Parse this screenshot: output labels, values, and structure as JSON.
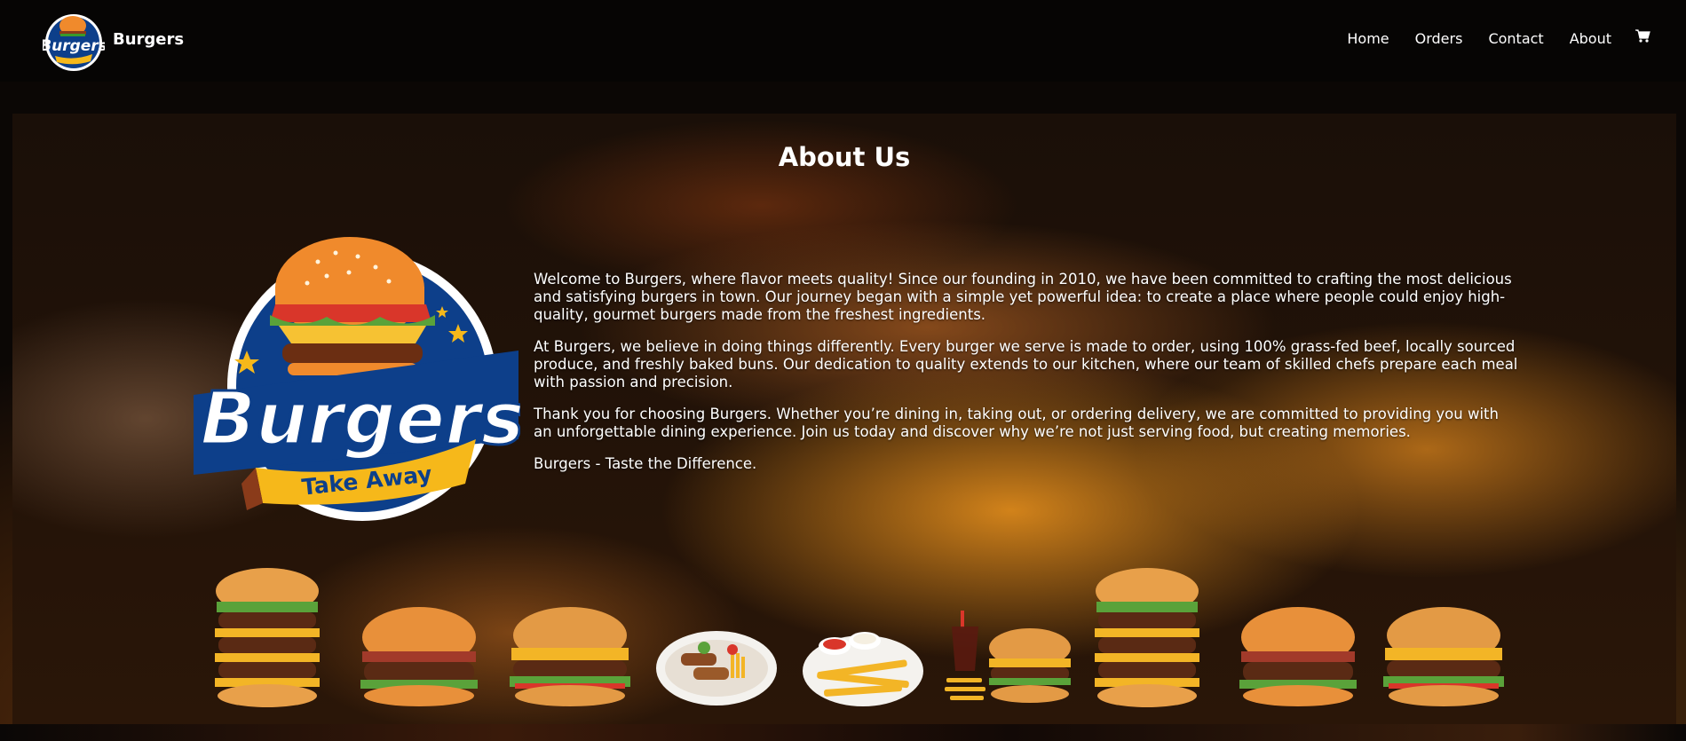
{
  "header": {
    "brand": "Burgers",
    "logo_text": "Burgers",
    "logo_sub": "TAKE AWAY",
    "nav": [
      "Home",
      "Orders",
      "Contact",
      "About"
    ],
    "cart_icon": "cart-icon"
  },
  "about": {
    "title": "About Us",
    "logo_text": "Burgers",
    "logo_sub": "Take Away",
    "paragraphs": [
      "Welcome to Burgers, where flavor meets quality! Since our founding in 2010, we have been committed to crafting the most delicious and satisfying burgers in town. Our journey began with a simple yet powerful idea: to create a place where people could enjoy high-quality, gourmet burgers made from the freshest ingredients.",
      "At Burgers, we believe in doing things differently. Every burger we serve is made to order, using 100% grass-fed beef, locally sourced produce, and freshly baked buns. Our dedication to quality extends to our kitchen, where our team of skilled chefs prepare each meal with passion and precision.",
      "Thank you for choosing Burgers. Whether you’re dining in, taking out, or ordering delivery, we are committed to providing you with an unforgettable dining experience. Join us today and discover why we’re not just serving food, but creating memories.",
      "Burgers - Taste the Difference."
    ]
  },
  "food_strip": [
    "tall-burger",
    "burger",
    "cheese-burger",
    "kebab-plate",
    "fries-plate",
    "burger-combo",
    "tall-burger",
    "burger",
    "cheese-burger"
  ],
  "colors": {
    "header_bg": "#060504",
    "logo_blue": "#0d3f8a",
    "logo_yellow": "#f6b81a",
    "bun_orange": "#f08a2c"
  }
}
